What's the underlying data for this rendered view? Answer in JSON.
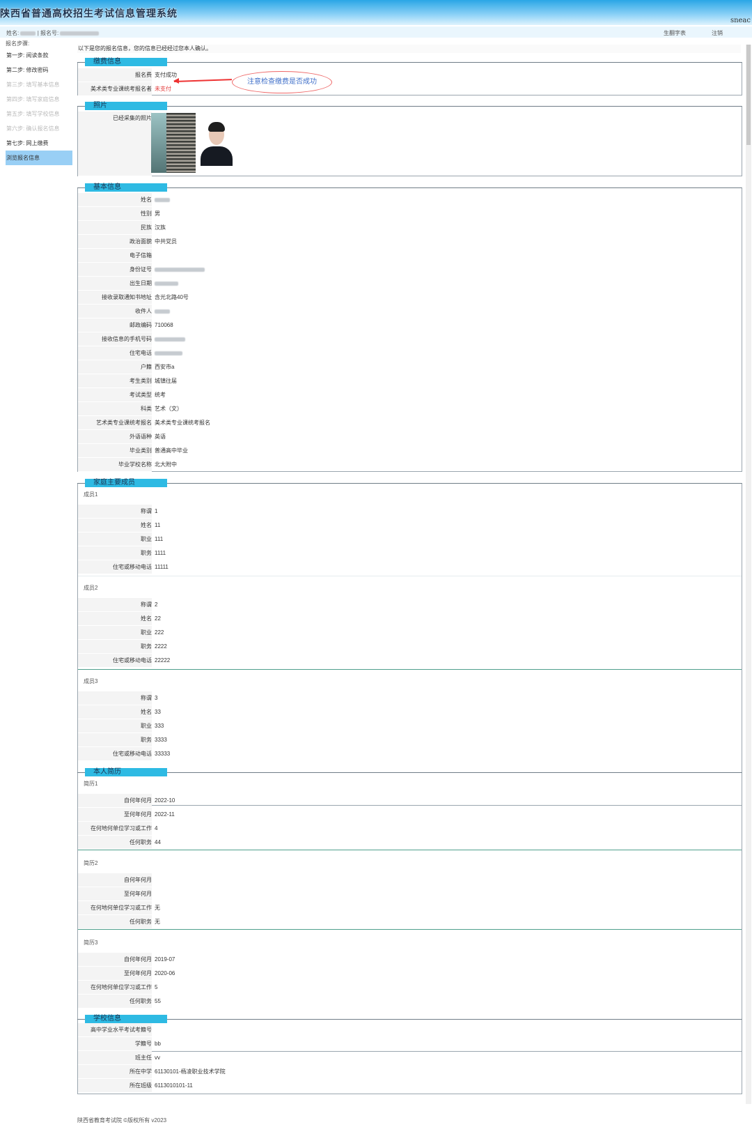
{
  "header": {
    "title": "陕西省普通高校招生考试信息管理系统",
    "brand": "sneac"
  },
  "userbar": {
    "name_label": "姓名:",
    "reg_label": "| 报名号:",
    "link_print": "生翻字表",
    "link_logout": "注销"
  },
  "sidebar": {
    "header": "报名步骤:",
    "steps": [
      "第一步: 阅读条款",
      "第二步: 修改密码",
      "第三步: 填写基本信息",
      "第四步: 填写家庭信息",
      "第五步: 填写学校信息",
      "第六步: 确认报名信息",
      "第七步: 网上缴费",
      "浏览报名信息"
    ]
  },
  "notice": "以下是您的报名信息，您的信息已经经过您本人确认。",
  "annotation": "注意检查缴费是否成功",
  "fee": {
    "legend": "缴费信息",
    "rows": [
      {
        "label": "报名费",
        "value": "支付成功"
      },
      {
        "label": "美术类专业课统考报名者",
        "value": "未支付"
      }
    ]
  },
  "photo": {
    "legend": "照片",
    "label": "已经采集的照片"
  },
  "basic": {
    "legend": "基本信息",
    "rows": [
      {
        "label": "姓名",
        "value": ""
      },
      {
        "label": "性别",
        "value": "男"
      },
      {
        "label": "民族",
        "value": "汉族"
      },
      {
        "label": "政治面貌",
        "value": "中共党员"
      },
      {
        "label": "电子信箱",
        "value": ""
      },
      {
        "label": "身份证号",
        "value": ""
      },
      {
        "label": "出生日期",
        "value": ""
      },
      {
        "label": "接收录取通知书地址",
        "value": "含光北路40号"
      },
      {
        "label": "收件人",
        "value": ""
      },
      {
        "label": "邮政编码",
        "value": "710068"
      },
      {
        "label": "接收信息的手机号码",
        "value": ""
      },
      {
        "label": "住宅电话",
        "value": ""
      },
      {
        "label": "户籍",
        "value": "西安市a"
      },
      {
        "label": "考生类别",
        "value": "城镇往届"
      },
      {
        "label": "考试类型",
        "value": "统考"
      },
      {
        "label": "科类",
        "value": "艺术（文）"
      },
      {
        "label": "艺术类专业课统考报名",
        "value": "美术类专业课统考报名"
      },
      {
        "label": "外语语种",
        "value": "英语"
      },
      {
        "label": "毕业类别",
        "value": "普通高中毕业"
      },
      {
        "label": "毕业学校名称",
        "value": "北大附中"
      }
    ]
  },
  "family": {
    "legend": "家庭主要成员",
    "members": [
      {
        "title": "成员1",
        "rows": [
          {
            "label": "称谓",
            "value": "1"
          },
          {
            "label": "姓名",
            "value": "11"
          },
          {
            "label": "职业",
            "value": "111"
          },
          {
            "label": "职务",
            "value": "1111"
          },
          {
            "label": "住宅或移动电话",
            "value": "11111"
          }
        ]
      },
      {
        "title": "成员2",
        "rows": [
          {
            "label": "称谓",
            "value": "2"
          },
          {
            "label": "姓名",
            "value": "22"
          },
          {
            "label": "职业",
            "value": "222"
          },
          {
            "label": "职务",
            "value": "2222"
          },
          {
            "label": "住宅或移动电话",
            "value": "22222"
          }
        ]
      },
      {
        "title": "成员3",
        "rows": [
          {
            "label": "称谓",
            "value": "3"
          },
          {
            "label": "姓名",
            "value": "33"
          },
          {
            "label": "职业",
            "value": "333"
          },
          {
            "label": "职务",
            "value": "3333"
          },
          {
            "label": "住宅或移动电话",
            "value": "33333"
          }
        ]
      }
    ]
  },
  "resume": {
    "legend": "本人简历",
    "entries": [
      {
        "title": "简历1",
        "rows": [
          {
            "label": "自何年何月",
            "value": "2022-10"
          },
          {
            "label": "至何年何月",
            "value": "2022-11"
          },
          {
            "label": "在何地何单位学习或工作",
            "value": "4"
          },
          {
            "label": "任何职务",
            "value": "44"
          }
        ]
      },
      {
        "title": "简历2",
        "rows": [
          {
            "label": "自何年何月",
            "value": ""
          },
          {
            "label": "至何年何月",
            "value": ""
          },
          {
            "label": "在何地何单位学习或工作",
            "value": "无"
          },
          {
            "label": "任何职务",
            "value": "无"
          }
        ]
      },
      {
        "title": "简历3",
        "rows": [
          {
            "label": "自何年何月",
            "value": "2019-07"
          },
          {
            "label": "至何年何月",
            "value": "2020-06"
          },
          {
            "label": "在何地何单位学习或工作",
            "value": "5"
          },
          {
            "label": "任何职务",
            "value": "55"
          }
        ]
      }
    ]
  },
  "school": {
    "legend": "学校信息",
    "rows": [
      {
        "label": "高中学业水平考试考籍号",
        "value": ""
      },
      {
        "label": "学籍号",
        "value": "bb"
      },
      {
        "label": "班主任",
        "value": "vv"
      },
      {
        "label": "所在中学",
        "value": "61130101-杨凌职业技术学院"
      },
      {
        "label": "所在班级",
        "value": "6113010101-11"
      }
    ]
  },
  "footer": "陕西省教育考试院 ©版权所有 v2023"
}
